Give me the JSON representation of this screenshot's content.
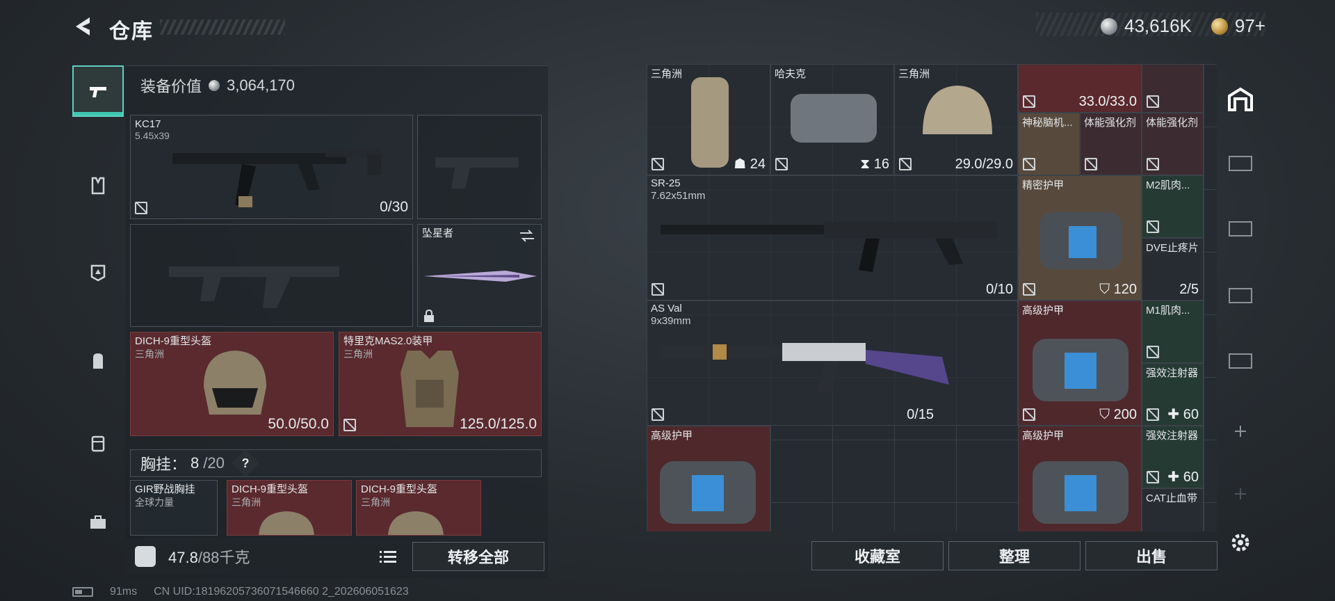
{
  "header": {
    "title": "仓库",
    "currency_silver": "43,616K",
    "currency_gold": "97+"
  },
  "left": {
    "equip_value_label": "装备价值",
    "equip_value": "3,064,170",
    "primary": {
      "name": "KC17",
      "caliber": "5.45x39",
      "ammo": "0/30"
    },
    "melee": {
      "name": "坠星者"
    },
    "helmet": {
      "name": "DICH-9重型头盔",
      "origin": "三角洲",
      "durability": "50.0/50.0"
    },
    "armor": {
      "name": "特里克MAS2.0装甲",
      "origin": "三角洲",
      "durability": "125.0/125.0"
    },
    "vest": {
      "label": "胸挂：",
      "count": "8",
      "capacity": "/20",
      "help": "?"
    },
    "vest_items": [
      {
        "name": "GIR野战胸挂",
        "origin": "全球力量"
      },
      {
        "name": "DICH-9重型头盔",
        "origin": "三角洲"
      },
      {
        "name": "DICH-9重型头盔",
        "origin": "三角洲"
      }
    ],
    "weight": {
      "current": "47.8",
      "max": "/88千克"
    },
    "transfer_all": "转移全部"
  },
  "status": {
    "ping": "91ms",
    "uid": "CN UID:18196205736071546660 2_202606051623"
  },
  "grid": {
    "bag1": {
      "origin": "三角洲",
      "count": "24"
    },
    "bag2": {
      "origin": "哈夫克",
      "count": "16"
    },
    "helmet": {
      "origin": "三角洲",
      "durability": "29.0/29.0"
    },
    "redcap": {
      "durability": "33.0/33.0"
    },
    "brain": {
      "name": "神秘脑机..."
    },
    "enhance1": {
      "name": "体能强化剂"
    },
    "enhance2": {
      "name": "体能强化剂"
    },
    "sr25": {
      "name": "SR-25",
      "caliber": "7.62x51mm",
      "ammo": "0/10"
    },
    "precise_armor": {
      "name": "精密护甲",
      "value": "120"
    },
    "m2": {
      "name": "M2肌肉..."
    },
    "dve": {
      "name": "DVE止疼片",
      "count": "2/5"
    },
    "asval": {
      "name": "AS Val",
      "caliber": "9x39mm",
      "ammo": "0/15"
    },
    "adv_armor1": {
      "name": "高级护甲",
      "value": "200"
    },
    "m1": {
      "name": "M1肌肉..."
    },
    "inject1": {
      "name": "强效注射器",
      "count": "60"
    },
    "adv_armor2": {
      "name": "高级护甲"
    },
    "adv_armor3": {
      "name": "高级护甲"
    },
    "inject2": {
      "name": "强效注射器",
      "count": "60"
    },
    "cat": {
      "name": "CAT止血带"
    }
  },
  "buttons": {
    "collection": "收藏室",
    "organize": "整理",
    "sell": "出售"
  },
  "colors": {
    "accent": "#3fc7b0",
    "red_slot": "#5a2a2e"
  }
}
